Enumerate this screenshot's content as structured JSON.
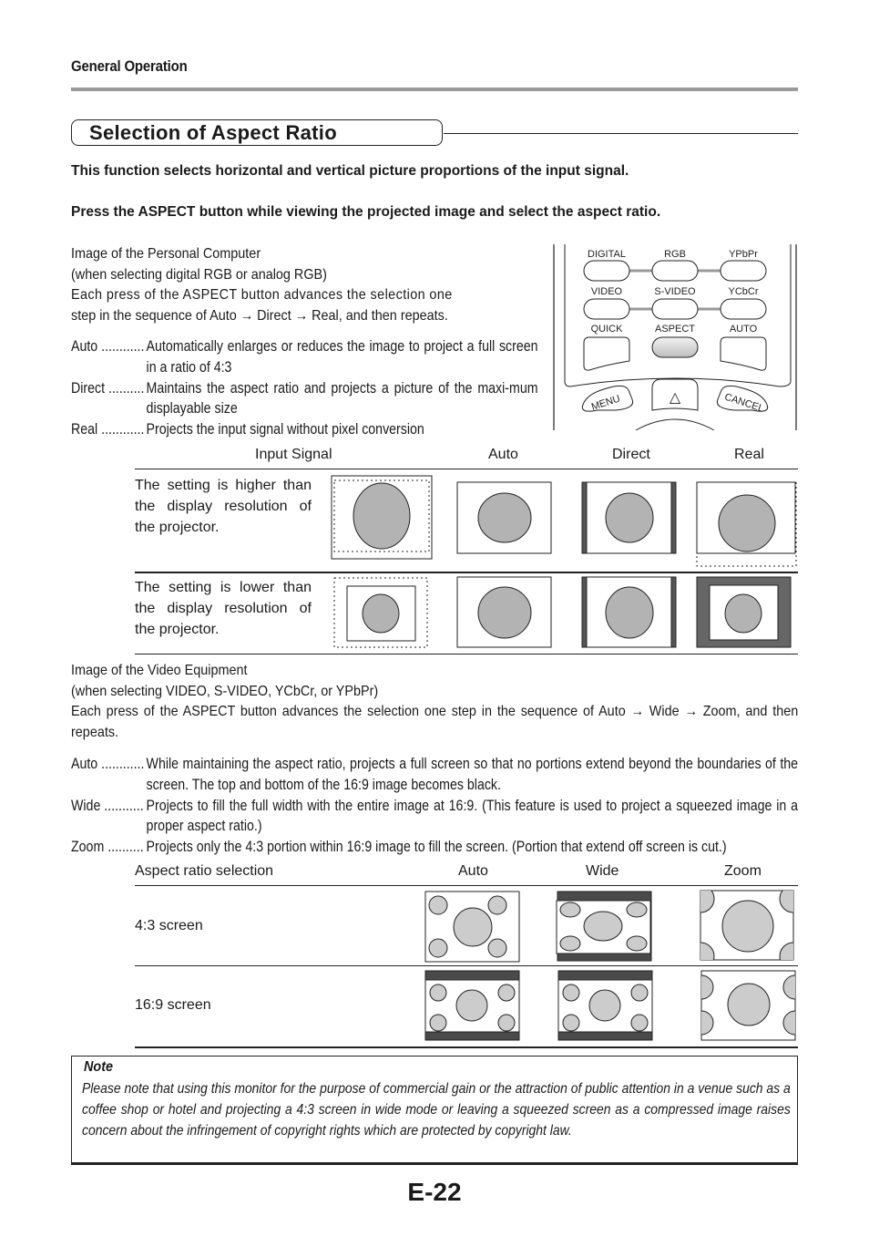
{
  "header": {
    "section": "General Operation"
  },
  "title": "Selection of Aspect Ratio",
  "intro": {
    "line1": "This function selects horizontal and vertical picture proportions of the input signal.",
    "line2": "Press the ASPECT button while viewing the projected image and select the aspect ratio."
  },
  "pc": {
    "heading": "Image of the Personal Computer",
    "subheading": "(when selecting digital RGB or analog RGB)",
    "sequence_1": "Each press of the ASPECT button advances the selection one",
    "sequence_2": "step in the sequence of Auto → Direct → Real, and then repeats.",
    "defs": [
      {
        "term": "Auto ............",
        "desc": "Automatically enlarges or reduces the image to project a full screen in a ratio of 4:3"
      },
      {
        "term": "Direct ..........",
        "desc": "Maintains the aspect ratio and projects a picture of the maxi-mum displayable size"
      },
      {
        "term": "Real ............",
        "desc": "Projects the input signal without pixel conversion"
      }
    ],
    "table": {
      "columns": [
        "Input Signal",
        "Auto",
        "Direct",
        "Real"
      ],
      "rows": [
        {
          "label": "The setting is higher than the display resolution of the projector."
        },
        {
          "label": "The setting is lower than the display resolution of the projector."
        }
      ]
    }
  },
  "remote": {
    "buttons": [
      [
        "DIGITAL",
        "RGB",
        "YPbPr"
      ],
      [
        "VIDEO",
        "S-VIDEO",
        "YCbCr"
      ],
      [
        "QUICK",
        "ASPECT",
        "AUTO"
      ]
    ],
    "highlighted": "ASPECT",
    "menu": "MENU",
    "cancel": "CANCEL",
    "up_arrow": "△"
  },
  "video": {
    "heading": "Image of the Video Equipment",
    "subheading": "(when selecting VIDEO, S-VIDEO, YCbCr, or YPbPr)",
    "sequence": "Each press of the ASPECT button advances the selection one step in the sequence of Auto → Wide → Zoom, and then repeats.",
    "defs": [
      {
        "term": "Auto ............",
        "desc": "While maintaining the aspect ratio, projects a full screen so that no portions extend beyond the boundaries of the screen. The top and bottom of the 16:9 image becomes black."
      },
      {
        "term": "Wide ...........",
        "desc": "Projects to fill the full width with the entire image at 16:9. (This feature is used to project a squeezed image in a proper aspect ratio.)"
      },
      {
        "term": "Zoom ..........",
        "desc": "Projects only the 4:3 portion within 16:9 image to fill the screen. (Portion that extend off screen is cut.)"
      }
    ],
    "table": {
      "columns": [
        "Aspect ratio selection",
        "Auto",
        "Wide",
        "Zoom"
      ],
      "rows": [
        {
          "label": "4:3 screen"
        },
        {
          "label": "16:9 screen"
        }
      ]
    }
  },
  "note": {
    "title": "Note",
    "text": "Please note that using this monitor for the purpose of commercial gain or the attraction of public attention in a venue such as a coffee shop or hotel and projecting a 4:3 screen in wide mode or leaving a squeezed screen as a compressed image raises concern about the infringement of copyright rights which are protected by copyright law."
  },
  "page_number": "E-22",
  "colors": {
    "ink": "#1a1a1a",
    "circle_fill": "#b3b3b3",
    "bar_dark": "#4a4a4a",
    "rule_gray": "#9a9a9a"
  }
}
